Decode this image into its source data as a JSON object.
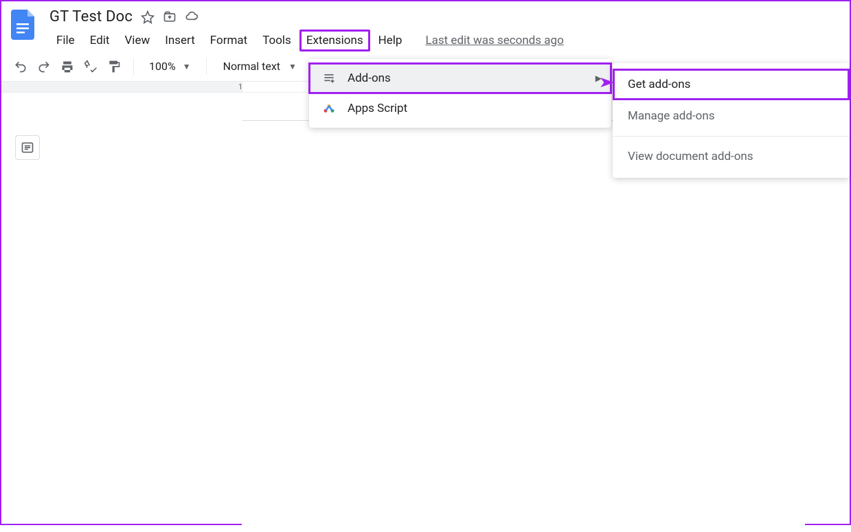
{
  "header": {
    "doc_title": "GT Test Doc",
    "menu": {
      "file": "File",
      "edit": "Edit",
      "view": "View",
      "insert": "Insert",
      "format": "Format",
      "tools": "Tools",
      "extensions": "Extensions",
      "help": "Help"
    },
    "last_edit": "Last edit was seconds ago"
  },
  "toolbar": {
    "zoom": "100%",
    "style": "Normal text"
  },
  "ruler": {
    "mark1": "1"
  },
  "extensions_menu": {
    "addons": "Add-ons",
    "apps_script": "Apps Script"
  },
  "addons_submenu": {
    "get": "Get add-ons",
    "manage": "Manage add-ons",
    "view_doc": "View document add-ons"
  }
}
